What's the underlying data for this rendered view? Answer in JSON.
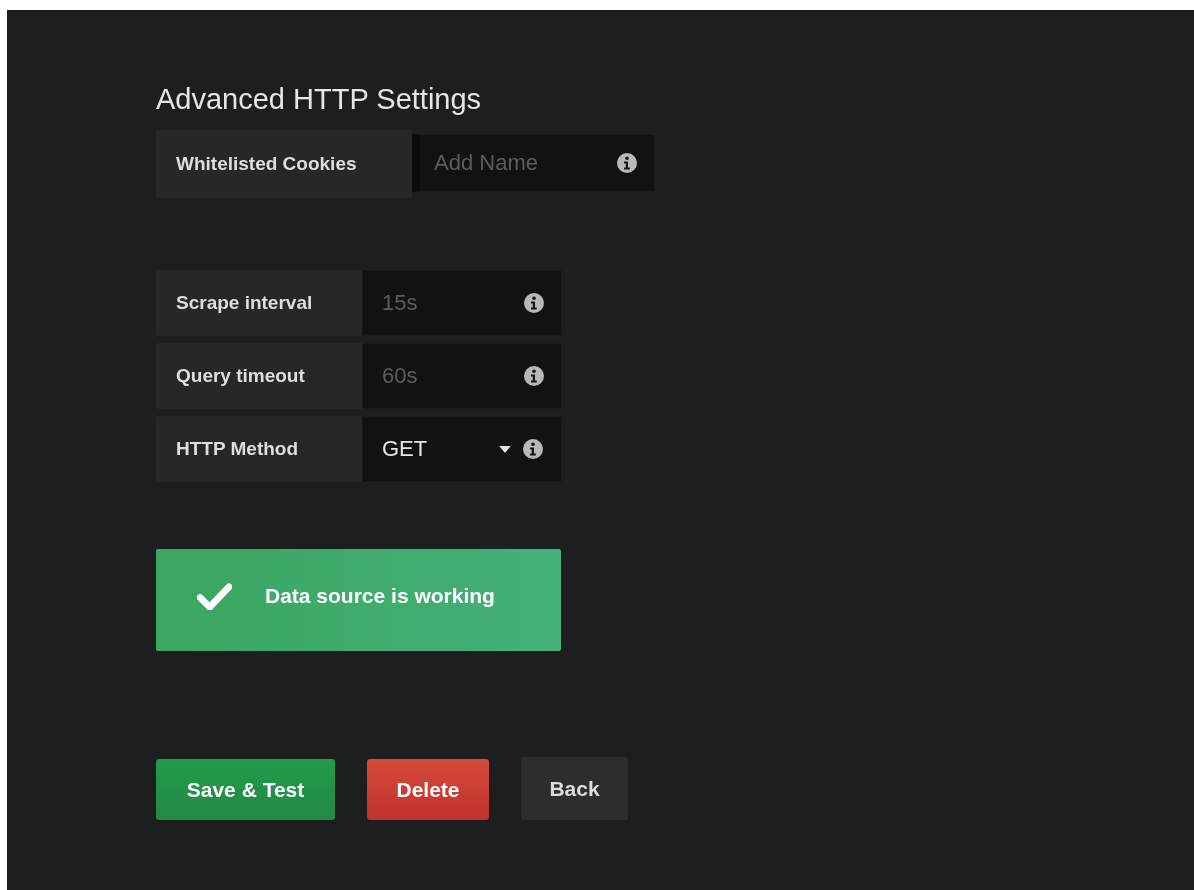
{
  "section_title": "Advanced HTTP Settings",
  "cookies": {
    "label": "Whitelisted Cookies",
    "placeholder": "Add Name"
  },
  "fields": [
    {
      "kind": "input",
      "label": "Scrape interval",
      "placeholder": "15s"
    },
    {
      "kind": "input",
      "label": "Query timeout",
      "placeholder": "60s"
    },
    {
      "kind": "select",
      "label": "HTTP Method",
      "value": "GET"
    }
  ],
  "alert": {
    "kind": "success",
    "text": "Data source is working"
  },
  "buttons": [
    {
      "kind": "primary",
      "label": "Save & Test"
    },
    {
      "kind": "danger",
      "label": "Delete"
    },
    {
      "kind": "secondary",
      "label": "Back"
    }
  ]
}
